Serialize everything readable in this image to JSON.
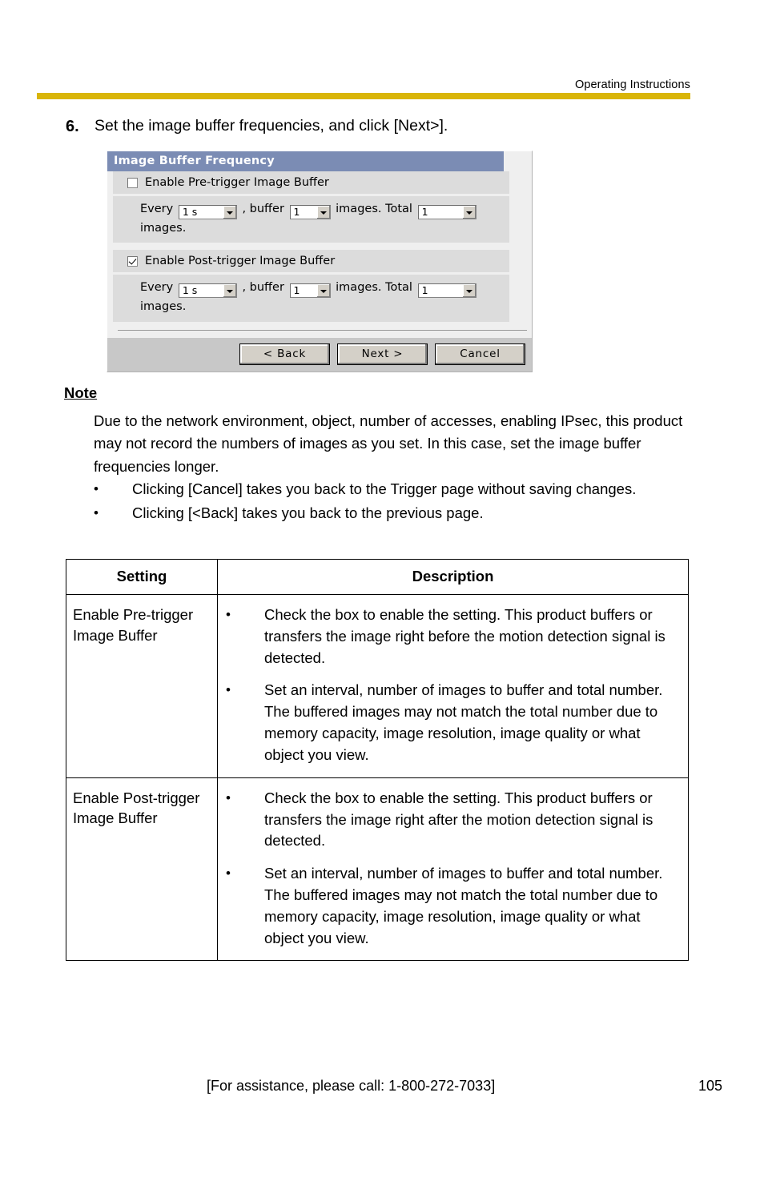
{
  "header": {
    "title": "Operating Instructions",
    "rule_color": "#d9b508"
  },
  "step": {
    "number": "6.",
    "text": "Set the image buffer frequencies, and click [Next>]."
  },
  "dialog": {
    "title": "Image Buffer Frequency",
    "titlebar_color": "#7b8cb4",
    "pre_trigger": {
      "checkbox_label": "Enable Pre-trigger Image Buffer",
      "checked": false,
      "label_every": "Every",
      "every_value": "1 s",
      "label_buffer": ", buffer",
      "buffer_value": "1",
      "label_images": "images. Total",
      "total_value": "1",
      "label_tail": "images."
    },
    "post_trigger": {
      "checkbox_label": "Enable Post-trigger Image Buffer",
      "checked": true,
      "label_every": "Every",
      "every_value": "1 s",
      "label_buffer": ", buffer",
      "buffer_value": "1",
      "label_images": "images. Total",
      "total_value": "1",
      "label_tail": "images."
    },
    "buttons": {
      "back": "< Back",
      "next": "Next >",
      "cancel": "Cancel"
    }
  },
  "note": {
    "title": "Note",
    "body": "Due to the network environment, object, number of accesses, enabling IPsec, this product may not record the numbers of images as you set. In this case, set the image buffer frequencies longer.",
    "bullet": "•",
    "items": [
      "Clicking [Cancel] takes you back to the Trigger page without saving changes.",
      "Clicking [<Back] takes you back to the previous page."
    ]
  },
  "table": {
    "headers": {
      "setting": "Setting",
      "description": "Description"
    },
    "bullet": "•",
    "rows": [
      {
        "setting": "Enable Pre-trigger Image Buffer",
        "points": [
          "Check the box to enable the setting. This product buffers or transfers the image right before the motion detection signal is detected.",
          "Set an interval, number of images to buffer and total number. The buffered images may not match the total number due to memory capacity, image resolution, image quality or what object you view."
        ]
      },
      {
        "setting": "Enable Post-trigger Image Buffer",
        "points": [
          "Check the box to enable the setting. This product buffers or transfers the image right after the motion detection signal is detected.",
          "Set an interval, number of images to buffer and total number. The buffered images may not match the total number due to memory capacity, image resolution, image quality or what object you view."
        ]
      }
    ]
  },
  "footer": {
    "assistance": "[For assistance, please call: 1-800-272-7033]",
    "page_number": "105"
  }
}
